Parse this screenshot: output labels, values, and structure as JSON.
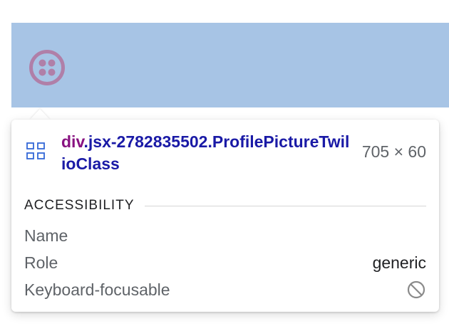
{
  "inspector": {
    "tag": "div",
    "classes": ".jsx-2782835502.ProfilePictureTwilioClass",
    "dimensions": "705 × 60"
  },
  "accessibility": {
    "title": "ACCESSIBILITY",
    "name_label": "Name",
    "name_value": "",
    "role_label": "Role",
    "role_value": "generic",
    "keyboard_label": "Keyboard-focusable",
    "keyboard_icon": "not-allowed-icon"
  },
  "colors": {
    "highlight": "#a7c4e5",
    "tag": "#881280",
    "classes": "#1a1aa6",
    "logo": "#b07fa8"
  }
}
